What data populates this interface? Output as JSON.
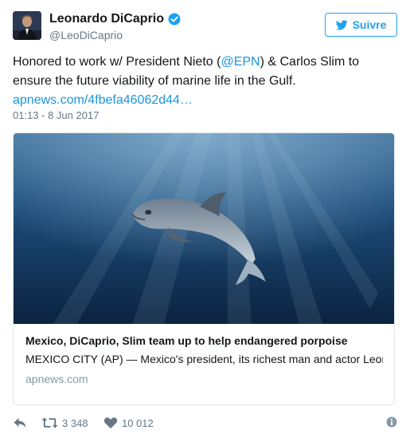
{
  "user": {
    "display_name": "Leonardo DiCaprio",
    "handle": "@LeoDiCaprio",
    "verified": true,
    "avatar_icon": "avatar-photo"
  },
  "follow_button": {
    "label": "Suivre",
    "icon": "twitter-bird-icon",
    "color": "#1da1f2"
  },
  "tweet": {
    "text_before_mention": "Honored to work w/ President Nieto (",
    "mention": "@EPN",
    "text_after_mention": ") & Carlos Slim to ensure the future viability of marine life in the Gulf.",
    "link": "apnews.com/4fbefa46062d44…",
    "timestamp": "01:13 - 8 Jun 2017",
    "link_color": "#1b95e0"
  },
  "card": {
    "image_subject": "vaquita porpoise underwater",
    "title": "Mexico, DiCaprio, Slim team up to help endangered porpoise",
    "description": "MEXICO CITY (AP) — Mexico's president, its richest man and actor Leonardo DiCaprio signed an agreement Wednesday to try to save the",
    "domain": "apnews.com"
  },
  "actions": {
    "reply_icon": "reply-icon",
    "retweet_icon": "retweet-icon",
    "retweet_count": "3 348",
    "like_icon": "heart-icon",
    "like_count": "10 012",
    "info_icon": "info-icon"
  }
}
